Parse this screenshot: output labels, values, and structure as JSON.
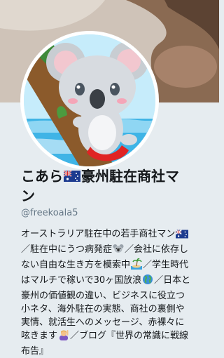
{
  "profile": {
    "name_part1": "こあら",
    "name_part2": "豪州駐在商社マ",
    "name_part3": "ン",
    "handle": "@freekoala5",
    "bio_lines": [
      "オーストラリア駐在中の若手商社マン",
      "／駐在中にうつ病発症",
      "／会社に依存し",
      "ない自由な生き方を模索中",
      "／学生時代",
      "はマルチで稼いで30ヶ国放浪",
      "／日本と",
      "豪州の価値観の違い、ビジネスに役立つ",
      "小ネタ、海外駐在の実態、商社の裏側や",
      "実情、就活生へのメッセージ、赤裸々に",
      "呟きます",
      "／ブログ『世界の常識に戦線",
      "布告』"
    ]
  },
  "icons": {
    "name_flag": "australia-flag-icon",
    "bio_flag": "australia-flag-icon",
    "bio_koala": "koala-emoji-icon",
    "bio_island": "desert-island-emoji-icon",
    "bio_globe": "globe-emoji-icon",
    "bio_person": "person-raising-hand-emoji-icon"
  },
  "colors": {
    "page_background": "#e6ecf0",
    "name_color": "#14171a",
    "handle_color": "#657786"
  }
}
